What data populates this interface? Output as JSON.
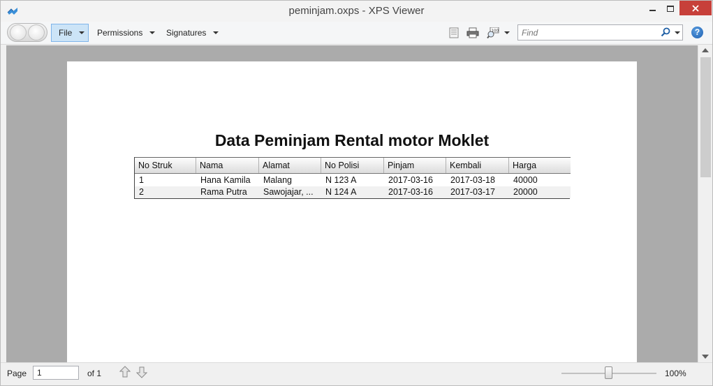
{
  "window": {
    "title": "peminjam.oxps - XPS Viewer"
  },
  "toolbar": {
    "file_label": "File",
    "permissions_label": "Permissions",
    "signatures_label": "Signatures",
    "find_placeholder": "Find",
    "help_label": "?"
  },
  "document": {
    "title": "Data Peminjam Rental motor Moklet",
    "columns": [
      "No Struk",
      "Nama",
      "Alamat",
      "No  Polisi",
      "Pinjam",
      "Kembali",
      "Harga"
    ],
    "rows": [
      [
        "1",
        "Hana  Kamila",
        "Malang",
        "N 123 A",
        "2017-03-16",
        "2017-03-18",
        "40000"
      ],
      [
        "2",
        "Rama  Putra",
        "Sawojajar, ...",
        "N 124 A",
        "2017-03-16",
        "2017-03-17",
        "20000"
      ]
    ]
  },
  "status": {
    "page_label": "Page",
    "page_value": "1",
    "of_label": "of 1",
    "zoom_label": "100%",
    "zoom_level_fraction": 0.5
  },
  "icons": {
    "app": "xps-viewer-icon",
    "minimize": "minimize-icon",
    "maximize": "maximize-icon",
    "close": "close-icon",
    "search": "search-icon",
    "help": "help-icon"
  },
  "colors": {
    "close_button": "#c7403a",
    "file_button_bg": "#cce4f7",
    "viewport_bg": "#ababab",
    "help_icon": "#1d5fb0"
  }
}
